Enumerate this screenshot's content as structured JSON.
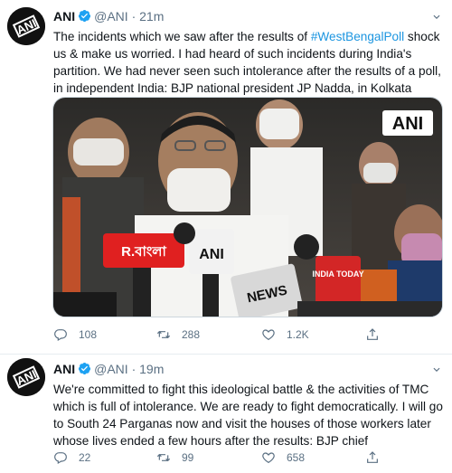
{
  "tweets": [
    {
      "author": "ANI",
      "handle": "@ANI",
      "separator": "·",
      "time": "21m",
      "text_before": "The incidents which we saw after the results of ",
      "hashtag": "#WestBengalPoll",
      "text_after": " shock us & make us worried. I had heard of such incidents during India's partition. We had never seen such intolerance after the results of a poll, in independent India: BJP national president JP Nadda, in Kolkata",
      "media_watermark": "ANI",
      "mic_labels": [
        "R.বাংলা",
        "ANI",
        "NEWS",
        "INDIA TODAY"
      ],
      "replies": "108",
      "retweets": "288",
      "likes": "1.2K"
    },
    {
      "author": "ANI",
      "handle": "@ANI",
      "separator": "·",
      "time": "19m",
      "text": "We're committed to fight this ideological battle & the activities of TMC which is full of intolerance. We are ready to fight democratically. I will go to South 24 Parganas now and visit the houses of those workers later whose lives ended a few hours after the results: BJP chief",
      "replies": "22",
      "retweets": "99",
      "likes": "658"
    }
  ],
  "avatar_text": "ANI",
  "icons": [
    "verified-badge-icon",
    "caret-down-icon",
    "reply-icon",
    "retweet-icon",
    "like-icon",
    "share-icon"
  ],
  "colors": {
    "accent": "#1da1f2",
    "hashtag": "#1b95e0",
    "muted": "#5b7083",
    "text": "#0f1419"
  }
}
